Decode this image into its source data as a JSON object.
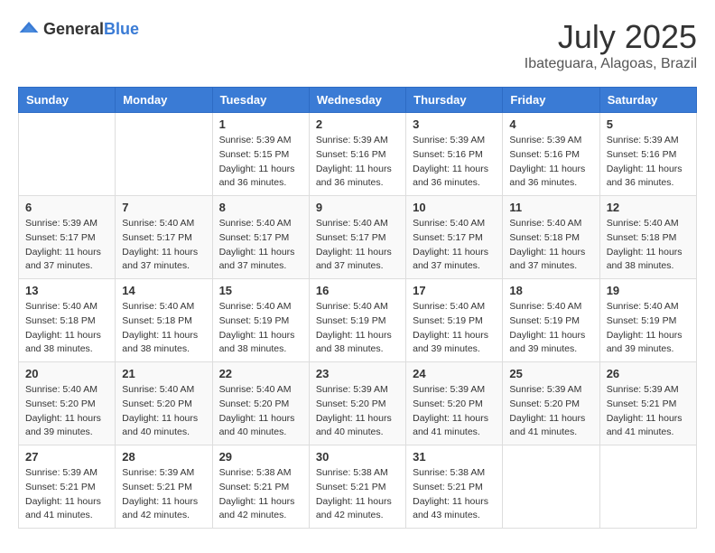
{
  "header": {
    "logo_general": "General",
    "logo_blue": "Blue",
    "month": "July 2025",
    "location": "Ibateguara, Alagoas, Brazil"
  },
  "days_of_week": [
    "Sunday",
    "Monday",
    "Tuesday",
    "Wednesday",
    "Thursday",
    "Friday",
    "Saturday"
  ],
  "weeks": [
    [
      {
        "day": "",
        "sunrise": "",
        "sunset": "",
        "daylight": ""
      },
      {
        "day": "",
        "sunrise": "",
        "sunset": "",
        "daylight": ""
      },
      {
        "day": "1",
        "sunrise": "Sunrise: 5:39 AM",
        "sunset": "Sunset: 5:15 PM",
        "daylight": "Daylight: 11 hours and 36 minutes."
      },
      {
        "day": "2",
        "sunrise": "Sunrise: 5:39 AM",
        "sunset": "Sunset: 5:16 PM",
        "daylight": "Daylight: 11 hours and 36 minutes."
      },
      {
        "day": "3",
        "sunrise": "Sunrise: 5:39 AM",
        "sunset": "Sunset: 5:16 PM",
        "daylight": "Daylight: 11 hours and 36 minutes."
      },
      {
        "day": "4",
        "sunrise": "Sunrise: 5:39 AM",
        "sunset": "Sunset: 5:16 PM",
        "daylight": "Daylight: 11 hours and 36 minutes."
      },
      {
        "day": "5",
        "sunrise": "Sunrise: 5:39 AM",
        "sunset": "Sunset: 5:16 PM",
        "daylight": "Daylight: 11 hours and 36 minutes."
      }
    ],
    [
      {
        "day": "6",
        "sunrise": "Sunrise: 5:39 AM",
        "sunset": "Sunset: 5:17 PM",
        "daylight": "Daylight: 11 hours and 37 minutes."
      },
      {
        "day": "7",
        "sunrise": "Sunrise: 5:40 AM",
        "sunset": "Sunset: 5:17 PM",
        "daylight": "Daylight: 11 hours and 37 minutes."
      },
      {
        "day": "8",
        "sunrise": "Sunrise: 5:40 AM",
        "sunset": "Sunset: 5:17 PM",
        "daylight": "Daylight: 11 hours and 37 minutes."
      },
      {
        "day": "9",
        "sunrise": "Sunrise: 5:40 AM",
        "sunset": "Sunset: 5:17 PM",
        "daylight": "Daylight: 11 hours and 37 minutes."
      },
      {
        "day": "10",
        "sunrise": "Sunrise: 5:40 AM",
        "sunset": "Sunset: 5:17 PM",
        "daylight": "Daylight: 11 hours and 37 minutes."
      },
      {
        "day": "11",
        "sunrise": "Sunrise: 5:40 AM",
        "sunset": "Sunset: 5:18 PM",
        "daylight": "Daylight: 11 hours and 37 minutes."
      },
      {
        "day": "12",
        "sunrise": "Sunrise: 5:40 AM",
        "sunset": "Sunset: 5:18 PM",
        "daylight": "Daylight: 11 hours and 38 minutes."
      }
    ],
    [
      {
        "day": "13",
        "sunrise": "Sunrise: 5:40 AM",
        "sunset": "Sunset: 5:18 PM",
        "daylight": "Daylight: 11 hours and 38 minutes."
      },
      {
        "day": "14",
        "sunrise": "Sunrise: 5:40 AM",
        "sunset": "Sunset: 5:18 PM",
        "daylight": "Daylight: 11 hours and 38 minutes."
      },
      {
        "day": "15",
        "sunrise": "Sunrise: 5:40 AM",
        "sunset": "Sunset: 5:19 PM",
        "daylight": "Daylight: 11 hours and 38 minutes."
      },
      {
        "day": "16",
        "sunrise": "Sunrise: 5:40 AM",
        "sunset": "Sunset: 5:19 PM",
        "daylight": "Daylight: 11 hours and 38 minutes."
      },
      {
        "day": "17",
        "sunrise": "Sunrise: 5:40 AM",
        "sunset": "Sunset: 5:19 PM",
        "daylight": "Daylight: 11 hours and 39 minutes."
      },
      {
        "day": "18",
        "sunrise": "Sunrise: 5:40 AM",
        "sunset": "Sunset: 5:19 PM",
        "daylight": "Daylight: 11 hours and 39 minutes."
      },
      {
        "day": "19",
        "sunrise": "Sunrise: 5:40 AM",
        "sunset": "Sunset: 5:19 PM",
        "daylight": "Daylight: 11 hours and 39 minutes."
      }
    ],
    [
      {
        "day": "20",
        "sunrise": "Sunrise: 5:40 AM",
        "sunset": "Sunset: 5:20 PM",
        "daylight": "Daylight: 11 hours and 39 minutes."
      },
      {
        "day": "21",
        "sunrise": "Sunrise: 5:40 AM",
        "sunset": "Sunset: 5:20 PM",
        "daylight": "Daylight: 11 hours and 40 minutes."
      },
      {
        "day": "22",
        "sunrise": "Sunrise: 5:40 AM",
        "sunset": "Sunset: 5:20 PM",
        "daylight": "Daylight: 11 hours and 40 minutes."
      },
      {
        "day": "23",
        "sunrise": "Sunrise: 5:39 AM",
        "sunset": "Sunset: 5:20 PM",
        "daylight": "Daylight: 11 hours and 40 minutes."
      },
      {
        "day": "24",
        "sunrise": "Sunrise: 5:39 AM",
        "sunset": "Sunset: 5:20 PM",
        "daylight": "Daylight: 11 hours and 41 minutes."
      },
      {
        "day": "25",
        "sunrise": "Sunrise: 5:39 AM",
        "sunset": "Sunset: 5:20 PM",
        "daylight": "Daylight: 11 hours and 41 minutes."
      },
      {
        "day": "26",
        "sunrise": "Sunrise: 5:39 AM",
        "sunset": "Sunset: 5:21 PM",
        "daylight": "Daylight: 11 hours and 41 minutes."
      }
    ],
    [
      {
        "day": "27",
        "sunrise": "Sunrise: 5:39 AM",
        "sunset": "Sunset: 5:21 PM",
        "daylight": "Daylight: 11 hours and 41 minutes."
      },
      {
        "day": "28",
        "sunrise": "Sunrise: 5:39 AM",
        "sunset": "Sunset: 5:21 PM",
        "daylight": "Daylight: 11 hours and 42 minutes."
      },
      {
        "day": "29",
        "sunrise": "Sunrise: 5:38 AM",
        "sunset": "Sunset: 5:21 PM",
        "daylight": "Daylight: 11 hours and 42 minutes."
      },
      {
        "day": "30",
        "sunrise": "Sunrise: 5:38 AM",
        "sunset": "Sunset: 5:21 PM",
        "daylight": "Daylight: 11 hours and 42 minutes."
      },
      {
        "day": "31",
        "sunrise": "Sunrise: 5:38 AM",
        "sunset": "Sunset: 5:21 PM",
        "daylight": "Daylight: 11 hours and 43 minutes."
      },
      {
        "day": "",
        "sunrise": "",
        "sunset": "",
        "daylight": ""
      },
      {
        "day": "",
        "sunrise": "",
        "sunset": "",
        "daylight": ""
      }
    ]
  ]
}
